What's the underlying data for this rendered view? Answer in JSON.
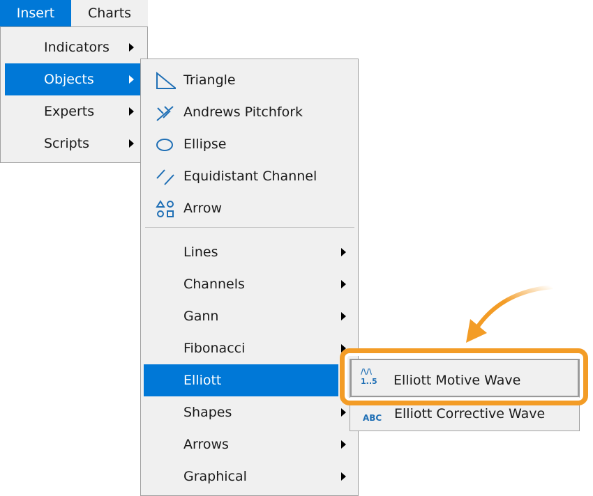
{
  "menubar": [
    {
      "label": "Insert",
      "active": true
    },
    {
      "label": "Charts",
      "active": false
    }
  ],
  "insert_menu": [
    {
      "label": "Indicators"
    },
    {
      "label": "Objects",
      "highlighted": true
    },
    {
      "label": "Experts"
    },
    {
      "label": "Scripts"
    }
  ],
  "objects_menu": {
    "icon_items": [
      {
        "label": "Triangle",
        "icon": "triangle-icon"
      },
      {
        "label": "Andrews Pitchfork",
        "icon": "pitchfork-icon"
      },
      {
        "label": "Ellipse",
        "icon": "ellipse-icon"
      },
      {
        "label": "Equidistant Channel",
        "icon": "channel-icon"
      },
      {
        "label": "Arrow",
        "icon": "shapes-icon"
      }
    ],
    "submenus": [
      {
        "label": "Lines"
      },
      {
        "label": "Channels"
      },
      {
        "label": "Gann"
      },
      {
        "label": "Fibonacci"
      },
      {
        "label": "Elliott",
        "highlighted": true
      },
      {
        "label": "Shapes"
      },
      {
        "label": "Arrows"
      },
      {
        "label": "Graphical"
      }
    ]
  },
  "elliott_menu": [
    {
      "label": "Elliott Motive Wave",
      "icon": "elliott-motive-icon",
      "icon_text": "1..5",
      "highlighted": true
    },
    {
      "label": "Elliott Corrective Wave",
      "icon": "elliott-corrective-icon",
      "icon_text": "ABC"
    }
  ],
  "colors": {
    "accent": "#0078d7",
    "callout": "#f39c26",
    "menu_bg": "#f0f0f0"
  }
}
